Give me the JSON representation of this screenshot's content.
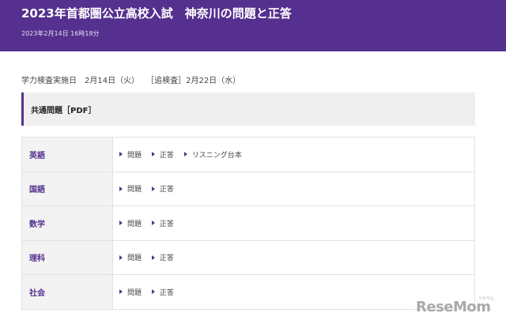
{
  "header": {
    "title": "2023年首都圏公立高校入試　神奈川の問題と正答",
    "date": "2023年2月14日 16時18分",
    "bg_color": "#55308f"
  },
  "schedule": {
    "main": "学力検査実施日　2月14日（火）",
    "supplementary": "［追検査］2月22日（水）"
  },
  "section": {
    "title": "共通問題［PDF］"
  },
  "subjects": [
    {
      "name": "英語",
      "links": [
        "問題",
        "正答",
        "リスニング台本"
      ]
    },
    {
      "name": "国語",
      "links": [
        "問題",
        "正答"
      ]
    },
    {
      "name": "数学",
      "links": [
        "問題",
        "正答"
      ]
    },
    {
      "name": "理科",
      "links": [
        "問題",
        "正答"
      ]
    },
    {
      "name": "社会",
      "links": [
        "問題",
        "正答"
      ]
    }
  ],
  "logo": {
    "text": "ReseMom",
    "kana": "リセマム"
  },
  "icons": {
    "link_marker": "triangle-right-icon"
  }
}
